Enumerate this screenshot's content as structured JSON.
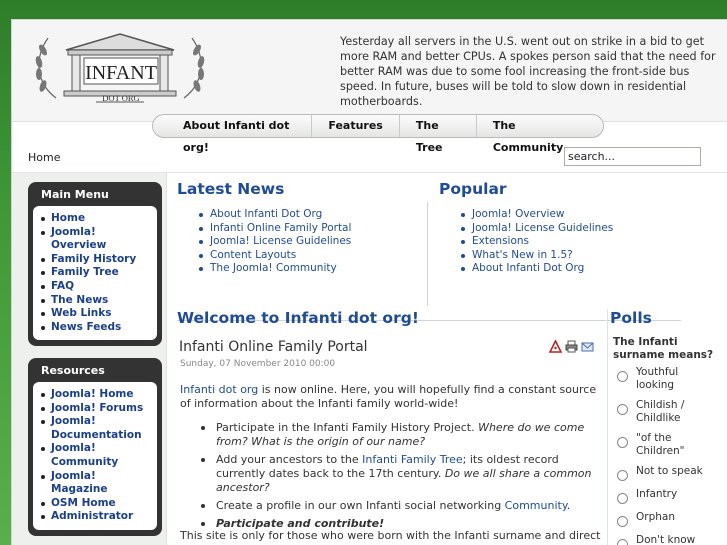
{
  "header": {
    "logo_text": "INFANT",
    "logo_sub": "DOT ORG",
    "message": "Yesterday all servers in the U.S. went out on strike in a bid to get more RAM and better CPUs. A spokes person said that the need for better RAM was due to some fool increasing the front-side bus speed. In future, buses will be told to slow down in residential motherboards."
  },
  "topnav": [
    "About Infanti dot org!",
    "Features",
    "The Tree",
    "The Community"
  ],
  "breadcrumb": "Home",
  "search": {
    "value": "search..."
  },
  "main_menu": {
    "title": "Main Menu",
    "items": [
      "Home",
      "Joomla! Overview",
      "Family History",
      "Family Tree",
      "FAQ",
      "The News",
      "Web Links",
      "News Feeds"
    ]
  },
  "resources": {
    "title": "Resources",
    "items": [
      "Joomla! Home",
      "Joomla! Forums",
      "Joomla! Documentation",
      "Joomla! Community",
      "Joomla! Magazine",
      "OSM Home",
      "Administrator"
    ]
  },
  "latest_news": {
    "title": "Latest News",
    "items": [
      "About Infanti Dot Org",
      "Infanti Online Family Portal",
      "Joomla! License Guidelines",
      "Content Layouts",
      "The Joomla! Community"
    ]
  },
  "popular": {
    "title": "Popular",
    "items": [
      "Joomla! Overview",
      "Joomla! License Guidelines",
      "Extensions",
      "What's New in 1.5?",
      "About Infanti Dot Org"
    ]
  },
  "main": {
    "welcome": "Welcome to Infanti dot org!",
    "article_title": "Infanti Online Family Portal",
    "article_date": "Sunday, 07 November 2010 00:00",
    "intro_link": "Infanti dot org",
    "intro_rest": " is now online. Here, you will hopefully find a constant source of information about the Infanti family world-wide!",
    "b1_plain": "Participate in the Infanti Family History Project. ",
    "b1_em": "Where do we come from? What is the origin of our name?",
    "b2_pre": "Add your ancestors to the ",
    "b2_link": "Infanti Family Tree",
    "b2_mid": "; its oldest record currently dates back to the 17th century. ",
    "b2_em": "Do we all share a common ancestor?",
    "b3_pre": "Create a profile in our own Infanti social networking ",
    "b3_link": "Community",
    "b3_post": ".",
    "b4": "Participate and contribute!",
    "outro": "This site is only for those who were born with the Infanti surname and direct relatives. Use of this site by anyone else is strictly prohibited."
  },
  "polls": {
    "title": "Polls",
    "question": "The Infanti surname means?",
    "options": [
      "Youthful looking",
      "Childish / Childlike",
      "\"of the Children\"",
      "Not to speak",
      "Infantry",
      "Orphan",
      "Don't know"
    ]
  },
  "colors": {
    "link": "#1f4c9a",
    "background_green": "#3f9a35",
    "module_dark": "#333333"
  }
}
